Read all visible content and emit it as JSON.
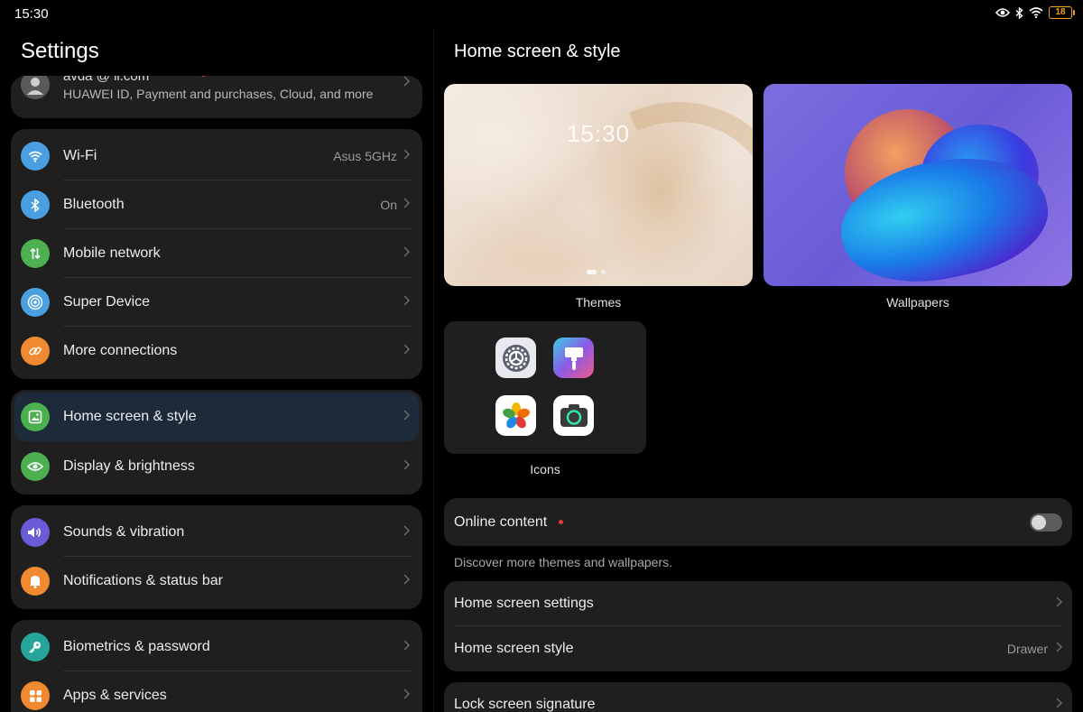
{
  "status_bar": {
    "time": "15:30",
    "battery": "18",
    "icons": [
      "eye-icon",
      "bluetooth-icon",
      "wifi-icon",
      "battery-icon"
    ]
  },
  "left": {
    "title": "Settings",
    "account": {
      "name": "avda     @     li.com",
      "subtitle": "HUAWEI ID, Payment and purchases, Cloud, and more"
    },
    "group_connect": [
      {
        "label": "Wi-Fi",
        "value": "Asus 5GHz",
        "icon": "wifi-icon",
        "color": "#4a9fe0"
      },
      {
        "label": "Bluetooth",
        "value": "On",
        "icon": "bluetooth-icon",
        "color": "#4a9fe0"
      },
      {
        "label": "Mobile network",
        "value": "",
        "icon": "mobile-network-icon",
        "color": "#4caf50"
      },
      {
        "label": "Super Device",
        "value": "",
        "icon": "super-device-icon",
        "color": "#4a9fe0"
      },
      {
        "label": "More connections",
        "value": "",
        "icon": "link-icon",
        "color": "#f08a30"
      }
    ],
    "group_display": [
      {
        "label": "Home screen & style",
        "icon": "image-icon",
        "color": "#4caf50",
        "selected": true
      },
      {
        "label": "Display & brightness",
        "icon": "eye-icon",
        "color": "#4caf50"
      }
    ],
    "group_sound": [
      {
        "label": "Sounds & vibration",
        "icon": "speaker-icon",
        "color": "#6a5bd6"
      },
      {
        "label": "Notifications & status bar",
        "icon": "bell-icon",
        "color": "#f08a30"
      }
    ],
    "group_security": [
      {
        "label": "Biometrics & password",
        "icon": "key-icon",
        "color": "#26a69a"
      },
      {
        "label": "Apps & services",
        "icon": "apps-icon",
        "color": "#f08a30"
      }
    ]
  },
  "right": {
    "title": "Home screen & style",
    "themes_label": "Themes",
    "themes_clock": "15:30",
    "wallpapers_label": "Wallpapers",
    "icons_label": "Icons",
    "icon_apps": [
      "settings-app-icon",
      "themes-app-icon",
      "photos-app-icon",
      "camera-app-icon"
    ],
    "online_content": {
      "label": "Online content",
      "enabled": false
    },
    "online_hint": "Discover more themes and wallpapers.",
    "home_screen_settings": "Home screen settings",
    "home_screen_style": {
      "label": "Home screen style",
      "value": "Drawer"
    },
    "lock_screen_signature": "Lock screen signature"
  }
}
